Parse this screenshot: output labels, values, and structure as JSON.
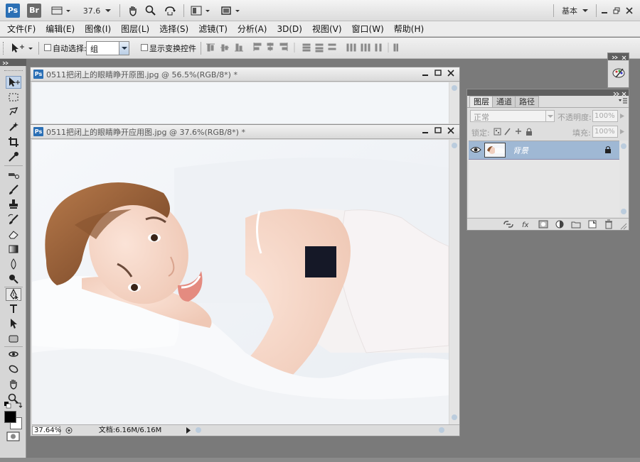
{
  "appbar": {
    "ps_logo": "Ps",
    "br_logo": "Br",
    "zoom_value": "37.6",
    "workspace": "基本"
  },
  "menu": [
    "文件(F)",
    "编辑(E)",
    "图像(I)",
    "图层(L)",
    "选择(S)",
    "滤镜(T)",
    "分析(A)",
    "3D(D)",
    "视图(V)",
    "窗口(W)",
    "帮助(H)"
  ],
  "options": {
    "auto_select_label": "自动选择:",
    "auto_select_value": "组",
    "show_transform_label": "显示变换控件"
  },
  "doc1": {
    "title": "0511把闭上的眼睛睁开原图.jpg @ 56.5%(RGB/8*) *"
  },
  "doc2": {
    "title": "0511把闭上的眼睛睁开应用图.jpg @ 37.6%(RGB/8*) *",
    "zoom": "37.64%",
    "doc_info": "文档:6.16M/6.16M"
  },
  "layers_panel": {
    "tabs": [
      "图层",
      "通道",
      "路径"
    ],
    "blend_mode": "正常",
    "opacity_label": "不透明度:",
    "opacity_value": "100%",
    "lock_label": "锁定:",
    "fill_label": "填充:",
    "fill_value": "100%",
    "layer_name": "背景"
  },
  "colors": {
    "accent_selected_layer": "#9fb8d4",
    "ps_blue": "#2a6fb5",
    "workspace_bg": "#7a7a7a"
  },
  "icons": [
    "hand-icon",
    "zoom-icon",
    "rotate-icon",
    "move-tool-icon",
    "eye-icon",
    "lock-icon",
    "link-icon",
    "fx-icon",
    "mask-icon",
    "adjustment-icon",
    "folder-icon",
    "new-layer-icon",
    "trash-icon"
  ]
}
